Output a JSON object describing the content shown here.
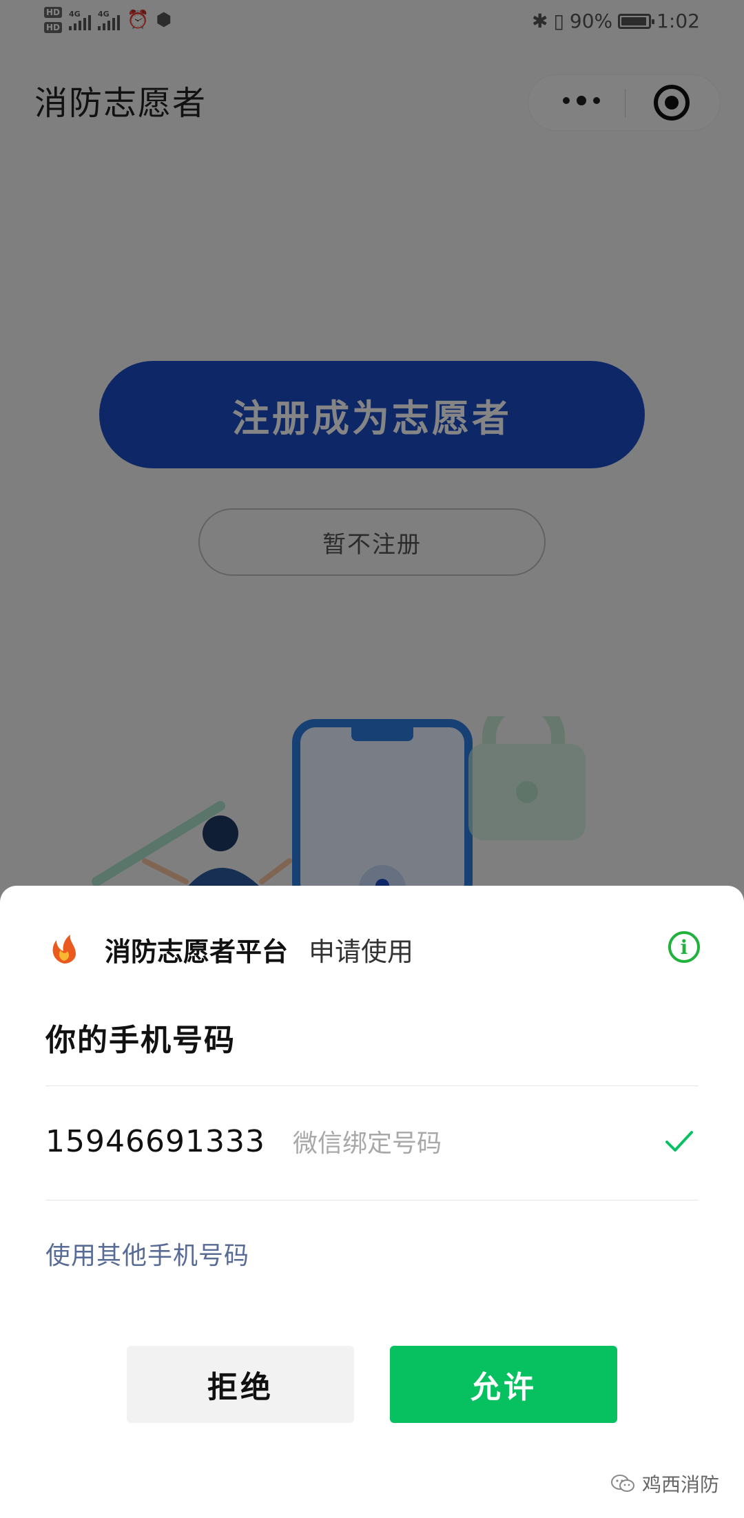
{
  "status_bar": {
    "hd1": "HD",
    "hd2": "HD",
    "net1": "4G",
    "net2": "4G",
    "battery_text": "90%",
    "battery_level": 0.9,
    "time": "1:02"
  },
  "nav": {
    "title": "消防志愿者"
  },
  "page": {
    "register_label": "注册成为志愿者",
    "skip_label": "暂不注册"
  },
  "sheet": {
    "app_name": "消防志愿者平台",
    "apply_text": "申请使用",
    "subtitle": "你的手机号码",
    "phone_number": "15946691333",
    "phone_note": "微信绑定号码",
    "other_phone_label": "使用其他手机号码",
    "deny_label": "拒绝",
    "allow_label": "允许"
  },
  "watermark": {
    "text": "鸡西消防"
  },
  "colors": {
    "primary_blue": "#1a4cc6",
    "wechat_green": "#07c160",
    "link_blue": "#576b95"
  }
}
